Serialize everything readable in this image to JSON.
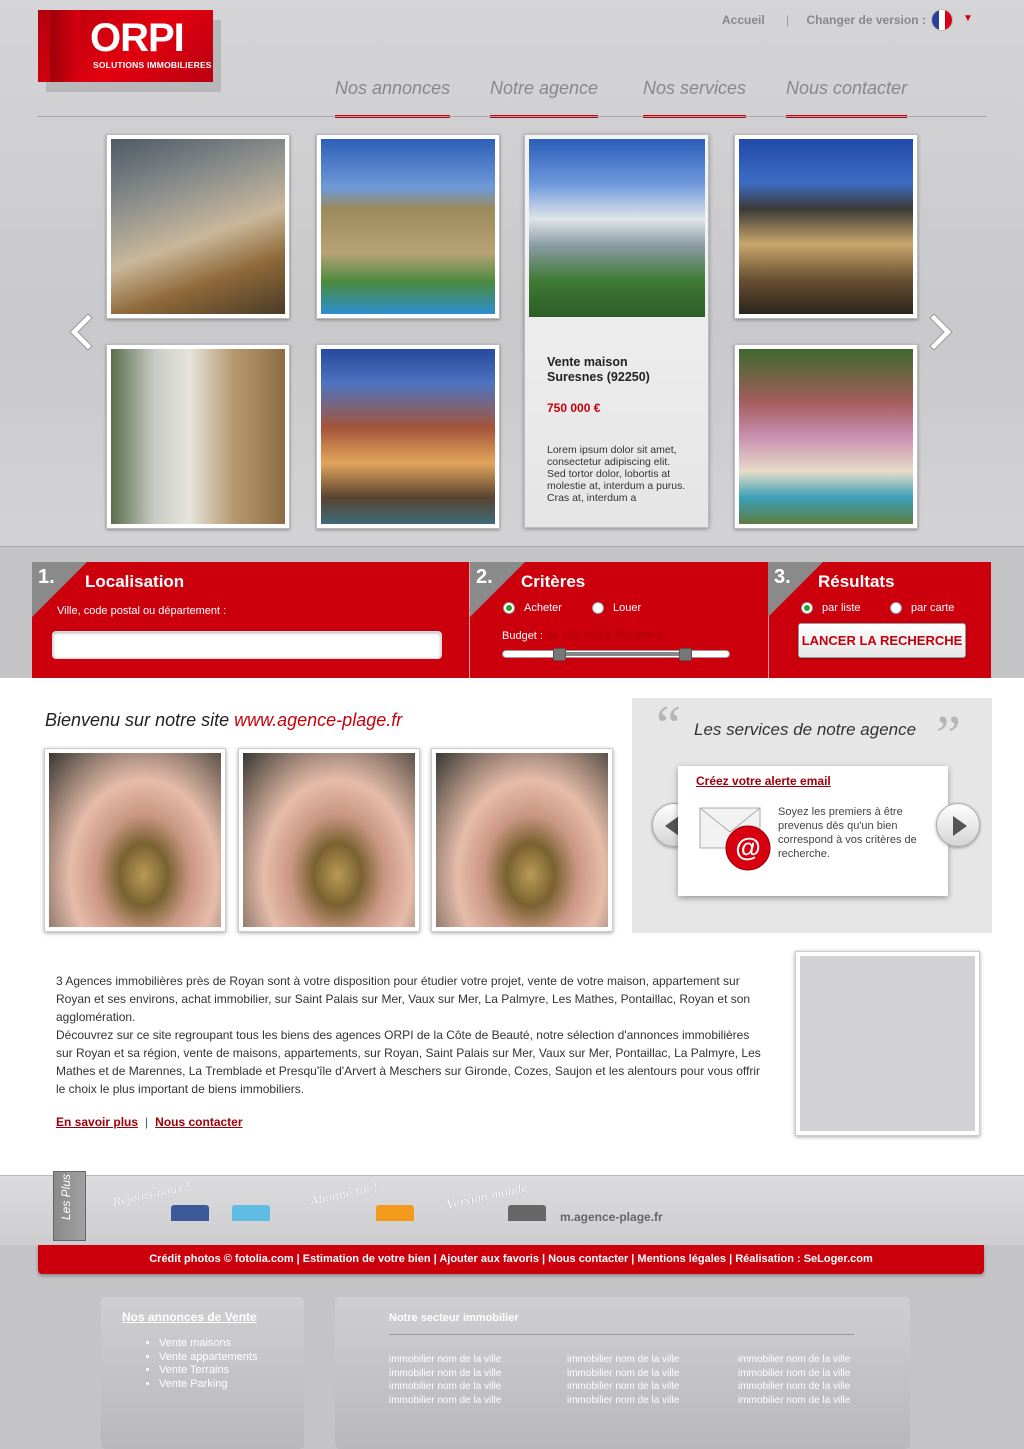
{
  "header": {
    "logo_text": "ORPI",
    "logo_tagline": "SOLUTIONS IMMOBILIERES",
    "home_link": "Accueil",
    "separator": "|",
    "change_version": "Changer de version :",
    "colors": {
      "brand_red": "#cc000d",
      "background": "#c9c9cc"
    }
  },
  "nav": {
    "items": [
      {
        "label": "Nos annonces"
      },
      {
        "label": "Notre agence"
      },
      {
        "label": "Nos services"
      },
      {
        "label": "Nous contacter"
      }
    ]
  },
  "carousel": {
    "prev_icon": "arrow-left-icon",
    "next_icon": "arrow-right-icon",
    "featured": {
      "title": "Vente maison Suresnes (92250)",
      "price": "750 000 €",
      "description": "Lorem ipsum dolor sit amet, consectetur adipiscing elit. Sed tortor dolor, lobortis at molestie at, interdum a purus. Cras at, interdum a"
    }
  },
  "search": {
    "step1": {
      "num": "1.",
      "title": "Localisation",
      "label": "Ville, code postal ou département :",
      "value": ""
    },
    "step2": {
      "num": "2.",
      "title": "Critères",
      "option1": "Acheter",
      "option2": "Louer",
      "selected": "Acheter",
      "budget_label": "Budget :",
      "budget_value": "de 150 000 à 750 000 €"
    },
    "step3": {
      "num": "3.",
      "title": "Résultats",
      "option1": "par liste",
      "option2": "par carte",
      "selected": "par liste",
      "button": "LANCER LA RECHERCHE"
    }
  },
  "welcome": {
    "text": "Bienvenu sur notre site",
    "url": "www.agence-plage.fr"
  },
  "services": {
    "title": "Les services de notre agence",
    "link": "Créez votre alerte email",
    "text": "Soyez les premiers à être prevenus dès qu'un bien correspond à vos critères de recherche."
  },
  "about": {
    "paragraph1": "3 Agences immobilières près de Royan sont à votre disposition pour étudier votre projet, vente de votre maison, appartement sur Royan et ses environs, achat immobilier, sur Saint Palais sur Mer, Vaux sur Mer, La Palmyre, Les Mathes, Pontaillac, Royan et son agglomération.",
    "paragraph2": "Découvrez sur ce site regroupant tous les biens des agences ORPI de la Côte de Beauté, notre sélection d'annonces immobilières sur Royan et sa région, vente de maisons, appartements, sur Royan, Saint Palais sur Mer, Vaux sur Mer, Pontaillac, La Palmyre, Les Mathes et de Marennes, La Tremblade et Presqu'île d'Arvert à Meschers sur Gironde, Cozes, Saujon et les alentours pour vous offrir le choix le plus important de biens immobiliers.",
    "link1": "En savoir plus",
    "link_sep": "|",
    "link2": "Nous contacter"
  },
  "social": {
    "tab": "Les Plus",
    "join": "Rejoins-nous !",
    "subscribe": "Abonne toi !",
    "mobile": "Version mobile",
    "mobile_url": "m.agence-plage.fr"
  },
  "footer_bar": {
    "text": "Crédit photos © fotolia.com | Estimation de votre bien | Ajouter aux favoris | Nous contacter | Mentions légales | Réalisation : SeLoger.com"
  },
  "footer": {
    "sale_title": "Nos annonces de Vente",
    "sale_items": [
      "Vente maisons",
      "Vente appartements",
      "Vente Terrains",
      "Vente Parking"
    ],
    "sector_title": "Notre secteur immobilier",
    "sector_item": "immobilier nom de la ville"
  }
}
